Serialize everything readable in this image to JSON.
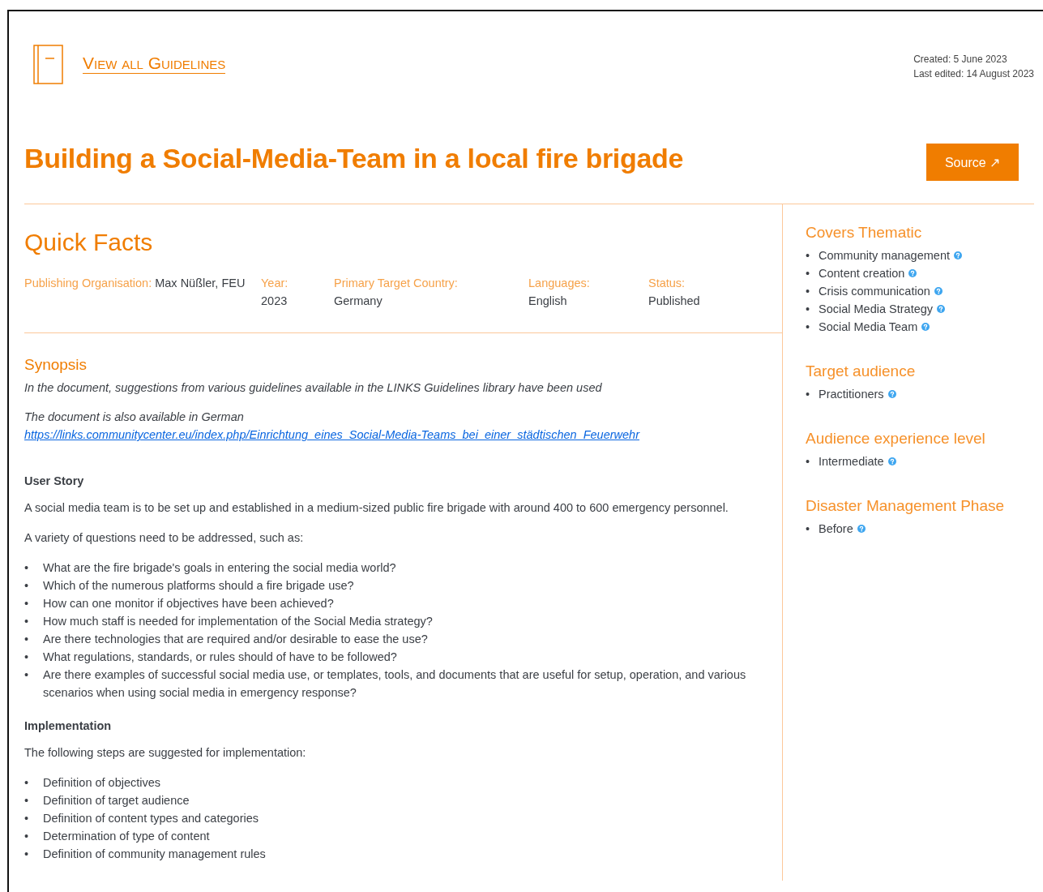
{
  "header": {
    "back_link": "View all Guidelines",
    "created": "Created: 5 June 2023",
    "last_edited": "Last edited: 14 August 2023"
  },
  "title": "Building a Social-Media-Team in a local fire brigade",
  "source_button": "Source ↗",
  "quick_facts": {
    "heading": "Quick Facts",
    "facts": [
      {
        "label": "Publishing Organisation:",
        "value": "Max Nüßler, FEU"
      },
      {
        "label": "Year:",
        "value": "2023"
      },
      {
        "label": "Primary Target Country:",
        "value": "Germany"
      },
      {
        "label": "Languages:",
        "value": "English"
      },
      {
        "label": "Status:",
        "value": "Published"
      }
    ]
  },
  "synopsis": {
    "heading": "Synopsis",
    "paragraphs": [
      {
        "text": "In the document, suggestions from various guidelines available in the LINKS Guidelines library have been used"
      },
      {
        "text": "The document is also available in German",
        "link": "https://links.communitycenter.eu/index.php/Einrichtung_eines_Social-Media-Teams_bei_einer_städtischen_Feuerwehr"
      }
    ]
  },
  "body": [
    {
      "kind": "heading",
      "text": "User Story"
    },
    {
      "kind": "paragraph",
      "text": "A social media team is to be set up and established in a medium-sized public fire brigade with around 400 to 600 emergency personnel."
    },
    {
      "kind": "paragraph",
      "text": "A variety of questions need to be addressed, such as:"
    },
    {
      "kind": "list",
      "marker": "•",
      "items": [
        "What are the fire brigade's goals in entering the social media world?",
        "Which of the numerous platforms should a fire brigade use?",
        "How can one monitor if objectives have been achieved?",
        "How much staff is needed for implementation of the Social Media strategy?",
        "Are there technologies that are required and/or desirable to ease the use?",
        "What regulations, standards, or rules should of have to be followed?",
        "Are there examples of successful social media use, or templates, tools, and documents that are useful for setup, operation, and various scenarios when using social media in emergency response?"
      ]
    },
    {
      "kind": "heading",
      "text": "Implementation"
    },
    {
      "kind": "paragraph",
      "text": "The following steps are suggested for implementation:"
    },
    {
      "kind": "list",
      "marker": "•",
      "items": [
        "Definition of objectives",
        "Definition of target audience",
        "Definition of content types and categories",
        "Determination of type of content",
        "Definition of community management rules"
      ]
    }
  ],
  "sidebar": [
    {
      "heading": "Covers Thematic",
      "marker": "•",
      "items": [
        "Community management",
        "Content creation",
        "Crisis communication",
        "Social Media Strategy",
        "Social Media Team"
      ]
    },
    {
      "heading": "Target audience",
      "marker": "•",
      "items": [
        "Practitioners"
      ]
    },
    {
      "heading": "Audience experience level",
      "marker": "•",
      "items": [
        "Intermediate"
      ]
    },
    {
      "heading": "Disaster Management Phase",
      "marker": "•",
      "items": [
        "Before"
      ]
    }
  ]
}
